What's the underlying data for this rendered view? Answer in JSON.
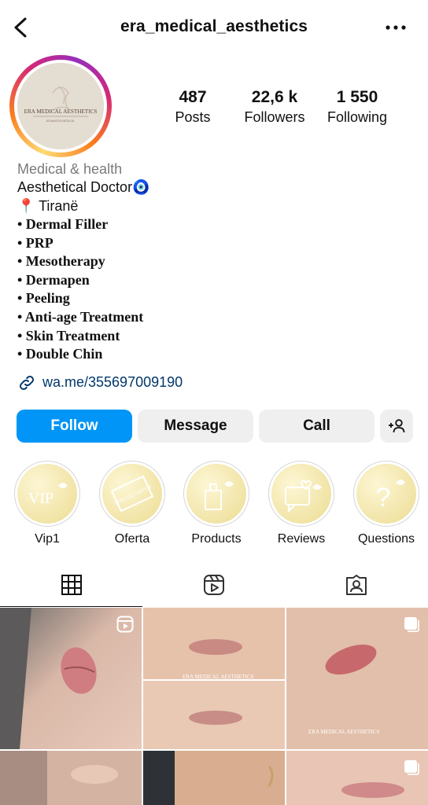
{
  "header": {
    "username": "era_medical_aesthetics",
    "back_icon": "chevron-left-icon",
    "more_icon": "more-horizontal-icon"
  },
  "profile": {
    "logo_text": "ERA MEDICAL AESTHETICS",
    "logo_sub": "ADVANCED MEDICAL",
    "stats": {
      "posts": {
        "value": "487",
        "label": "Posts"
      },
      "followers": {
        "value": "22,6 k",
        "label": "Followers"
      },
      "following": {
        "value": "1 550",
        "label": "Following"
      }
    }
  },
  "bio": {
    "category": "Medical & health",
    "title": "Aesthetical Doctor🧿",
    "location": "📍 Tiranë",
    "services": [
      "• Dermal Filler",
      "• PRP",
      "• Mesotherapy",
      "• Dermapen",
      "• Peeling",
      "• Anti-age Treatment",
      "• Skin Treatment",
      "• Double Chin"
    ],
    "link": "wa.me/355697009190"
  },
  "actions": {
    "follow": "Follow",
    "message": "Message",
    "call": "Call",
    "add_user_icon": "add-user-icon"
  },
  "highlights": [
    {
      "label": "Vip1",
      "art": "VIP"
    },
    {
      "label": "Oferta",
      "art": "SPECIAL OFFER"
    },
    {
      "label": "Products",
      "art": ""
    },
    {
      "label": "Reviews",
      "art": ""
    },
    {
      "label": "Questions",
      "art": "?"
    }
  ],
  "tabs": [
    {
      "name": "posts-grid",
      "icon": "grid-icon",
      "active": true
    },
    {
      "name": "reels",
      "icon": "reels-icon",
      "active": false
    },
    {
      "name": "tagged",
      "icon": "tagged-icon",
      "active": false
    }
  ],
  "grid_posts": [
    {
      "kind": "reel",
      "badge": "reels-icon"
    },
    {
      "kind": "photo",
      "watermark": "ERA MEDICAL AESTHETICS"
    },
    {
      "kind": "carousel",
      "badge": "carousel-icon",
      "watermark": "ERA MEDICAL AESTHETICS"
    },
    {
      "kind": "photo"
    },
    {
      "kind": "photo"
    },
    {
      "kind": "carousel",
      "badge": "carousel-icon"
    }
  ],
  "colors": {
    "follow_button": "#0095f6",
    "secondary_button": "#efefef",
    "link": "#00376b",
    "category_gray": "#7a7a7a"
  }
}
